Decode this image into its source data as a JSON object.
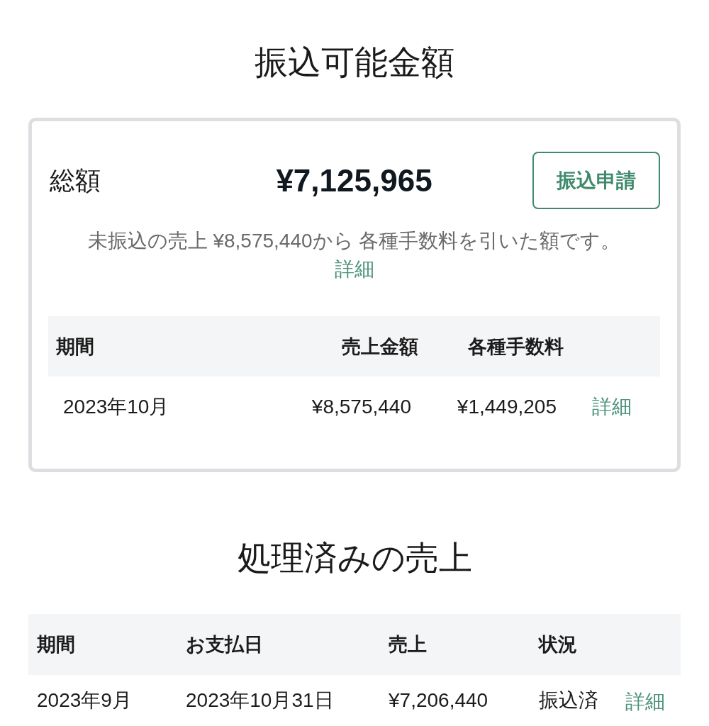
{
  "available": {
    "title": "振込可能金額",
    "total_label": "総額",
    "total_amount": "¥7,125,965",
    "apply_button": "振込申請",
    "note": "未振込の売上 ¥8,575,440から 各種手数料を引いた額です。",
    "detail_link": "詳細",
    "table": {
      "columns": [
        "期間",
        "売上金額",
        "各種手数料"
      ],
      "rows": [
        {
          "cells": [
            "2023年10月",
            "¥8,575,440",
            "¥1,449,205"
          ],
          "link": "詳細"
        }
      ]
    }
  },
  "processed": {
    "title": "処理済みの売上",
    "table": {
      "columns": [
        "期間",
        "お支払日",
        "売上",
        "状況"
      ],
      "rows": [
        {
          "cells": [
            "2023年9月",
            "2023年10月31日",
            "¥7,206,440",
            "振込済"
          ],
          "link": "詳細"
        }
      ]
    }
  }
}
